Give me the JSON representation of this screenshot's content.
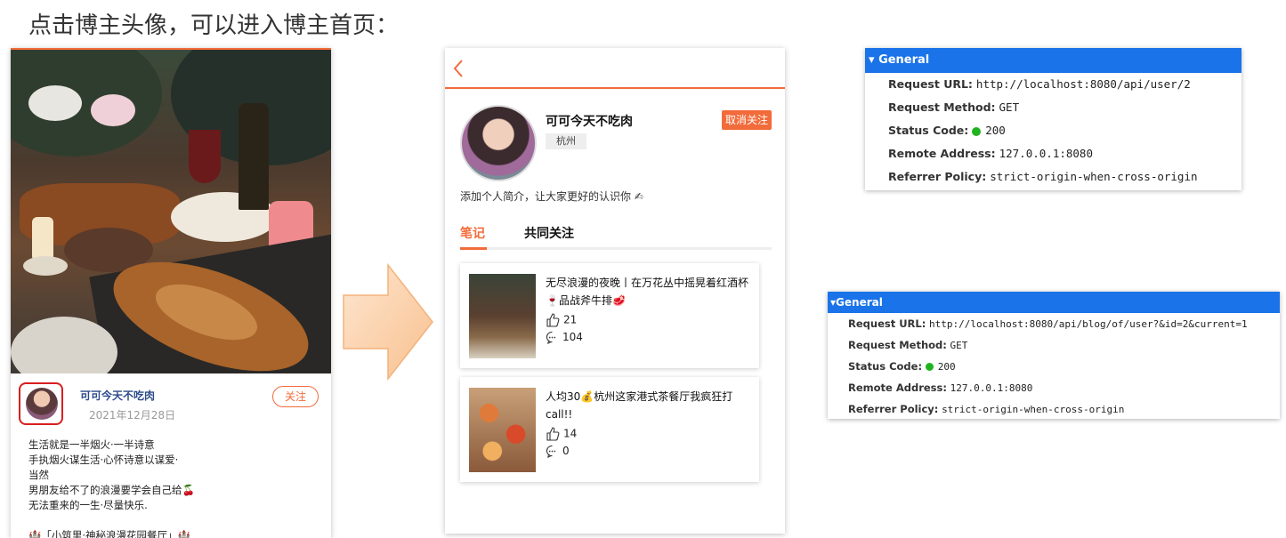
{
  "slide": {
    "title": "点击博主头像，可以进入博主首页："
  },
  "blog_detail": {
    "author_name": "可可今天不吃肉",
    "date": "2021年12月28日",
    "follow_label": "关注",
    "content_lines": [
      "生活就是一半烟火·一半诗意",
      "手执烟火谋生活·心怀诗意以谋爱·",
      "当然",
      "男朋友给不了的浪漫要学会自己给🍒",
      "无法重来的一生·尽量快乐.",
      "",
      "🏰「小筑里·神秘浪漫花园餐厅」🏰"
    ]
  },
  "user_home": {
    "name": "可可今天不吃肉",
    "city": "杭州",
    "unfollow_label": "取消关注",
    "intro": "添加个人简介，让大家更好的认识你 ✍",
    "tabs": [
      "笔记",
      "共同关注"
    ],
    "notes": [
      {
        "title": "无尽浪漫的夜晚丨在万花丛中摇晃着红酒杯🍷品战斧牛排🥩",
        "likes": "21",
        "comments": "104"
      },
      {
        "title": "人均30💰杭州这家港式茶餐厅我疯狂打call!!",
        "likes": "14",
        "comments": "0"
      }
    ]
  },
  "devtools": [
    {
      "header": "General",
      "request_url_label": "Request URL:",
      "request_url": "http://localhost:8080/api/user/2",
      "method_label": "Request Method:",
      "method": "GET",
      "status_label": "Status Code:",
      "status": "200",
      "remote_label": "Remote Address:",
      "remote": "127.0.0.1:8080",
      "referrer_label": "Referrer Policy:",
      "referrer": "strict-origin-when-cross-origin"
    },
    {
      "header": "General",
      "request_url_label": "Request URL:",
      "request_url": "http://localhost:8080/api/blog/of/user?&id=2&current=1",
      "method_label": "Request Method:",
      "method": "GET",
      "status_label": "Status Code:",
      "status": "200",
      "remote_label": "Remote Address:",
      "remote": "127.0.0.1:8080",
      "referrer_label": "Referrer Policy:",
      "referrer": "strict-origin-when-cross-origin"
    }
  ],
  "colors": {
    "accent": "#f26b3a",
    "devtools_header": "#1a73e8",
    "status_ok": "#1fb41f",
    "highlight_border": "#d81e1e"
  },
  "icons": [
    "back-chevron-icon",
    "like-thumb-icon",
    "comment-icon",
    "triangle-down-icon",
    "status-dot-icon",
    "right-arrow-icon"
  ]
}
